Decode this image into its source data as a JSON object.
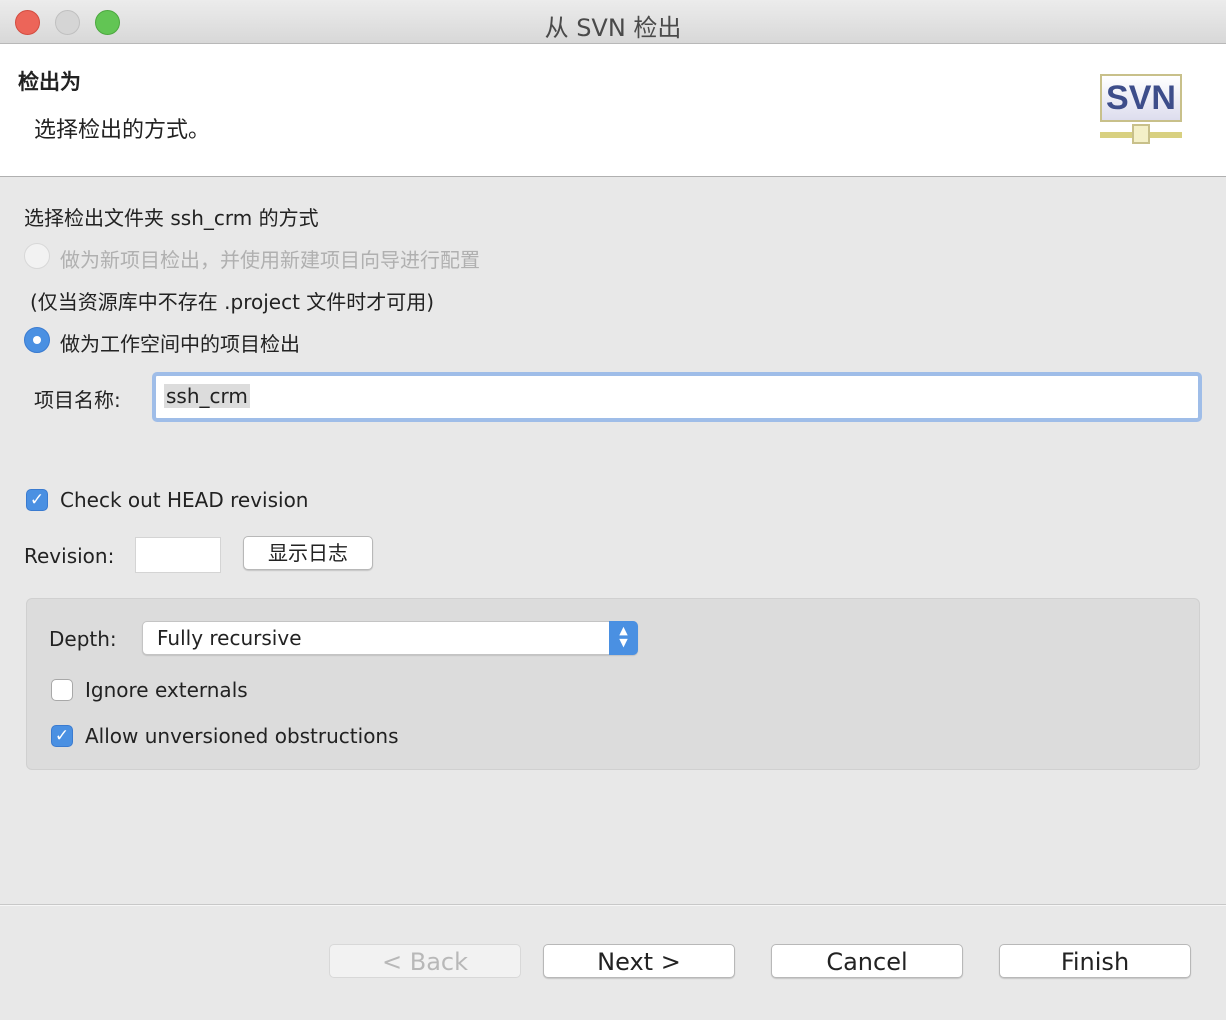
{
  "window": {
    "title": "从 SVN 检出"
  },
  "header": {
    "title": "检出为",
    "description": "选择检出的方式。",
    "logo_text": "SVN"
  },
  "main": {
    "prompt": "选择检出文件夹 ssh_crm 的方式",
    "option_new_project": "做为新项目检出，并使用新建项目向导进行配置",
    "option_new_project_note": "(仅当资源库中不存在 .project 文件时才可用)",
    "option_workspace": "做为工作空间中的项目检出",
    "project_name_label": "项目名称:",
    "project_name_value": "ssh_crm",
    "head_revision_label": "Check out HEAD revision",
    "head_revision_checked": true,
    "revision_label": "Revision:",
    "revision_value": "",
    "show_log_label": "显示日志",
    "depth_label": "Depth:",
    "depth_value": "Fully recursive",
    "ignore_externals_label": "Ignore externals",
    "ignore_externals_checked": false,
    "allow_unversioned_label": "Allow unversioned obstructions",
    "allow_unversioned_checked": true
  },
  "footer": {
    "back": "< Back",
    "next": "Next >",
    "cancel": "Cancel",
    "finish": "Finish"
  },
  "colors": {
    "accent": "#4a90e2",
    "close": "#ec6559",
    "minimize": "#d5d5d5",
    "zoom": "#62c554"
  }
}
